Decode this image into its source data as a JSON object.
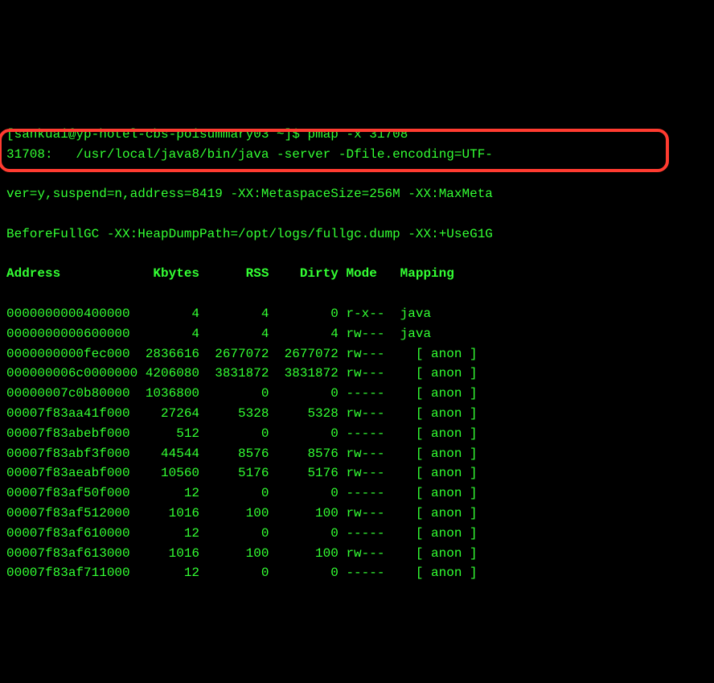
{
  "prompt": {
    "user_host": "[sankuai@yp-hotel-cbs-poisummary03 ~]$",
    "command": "pmap -x 31708"
  },
  "proc_header": {
    "line1": "31708:   /usr/local/java8/bin/java -server -Dfile.encoding=UTF-",
    "line2": "ver=y,suspend=n,address=8419 -XX:MetaspaceSize=256M -XX:MaxMeta",
    "line3": "BeforeFullGC -XX:HeapDumpPath=/opt/logs/fullgc.dump -XX:+UseG1G"
  },
  "columns": {
    "c0": "Address",
    "c1": "Kbytes",
    "c2": "RSS",
    "c3": "Dirty",
    "c4": "Mode",
    "c5": "Mapping"
  },
  "rows": [
    {
      "addr": "0000000000400000",
      "kb": "4",
      "rss": "4",
      "dirty": "0",
      "mode": "r-x--",
      "map": "java"
    },
    {
      "addr": "0000000000600000",
      "kb": "4",
      "rss": "4",
      "dirty": "4",
      "mode": "rw---",
      "map": "java"
    },
    {
      "addr": "0000000000fec000",
      "kb": "2836616",
      "rss": "2677072",
      "dirty": "2677072",
      "mode": "rw---",
      "map": "  [ anon ]"
    },
    {
      "addr": "000000006c0000000",
      "kb": "4206080",
      "rss": "3831872",
      "dirty": "3831872",
      "mode": "rw---",
      "map": "  [ anon ]"
    },
    {
      "addr": "00000007c0b80000",
      "kb": "1036800",
      "rss": "0",
      "dirty": "0",
      "mode": "-----",
      "map": "  [ anon ]"
    },
    {
      "addr": "00007f83aa41f000",
      "kb": "27264",
      "rss": "5328",
      "dirty": "5328",
      "mode": "rw---",
      "map": "  [ anon ]"
    },
    {
      "addr": "00007f83abebf000",
      "kb": "512",
      "rss": "0",
      "dirty": "0",
      "mode": "-----",
      "map": "  [ anon ]"
    },
    {
      "addr": "00007f83abf3f000",
      "kb": "44544",
      "rss": "8576",
      "dirty": "8576",
      "mode": "rw---",
      "map": "  [ anon ]"
    },
    {
      "addr": "00007f83aeabf000",
      "kb": "10560",
      "rss": "5176",
      "dirty": "5176",
      "mode": "rw---",
      "map": "  [ anon ]"
    },
    {
      "addr": "00007f83af50f000",
      "kb": "12",
      "rss": "0",
      "dirty": "0",
      "mode": "-----",
      "map": "  [ anon ]"
    },
    {
      "addr": "00007f83af512000",
      "kb": "1016",
      "rss": "100",
      "dirty": "100",
      "mode": "rw---",
      "map": "  [ anon ]"
    },
    {
      "addr": "00007f83af610000",
      "kb": "12",
      "rss": "0",
      "dirty": "0",
      "mode": "-----",
      "map": "  [ anon ]"
    },
    {
      "addr": "00007f83af613000",
      "kb": "1016",
      "rss": "100",
      "dirty": "100",
      "mode": "rw---",
      "map": "  [ anon ]"
    },
    {
      "addr": "00007f83af711000",
      "kb": "12",
      "rss": "0",
      "dirty": "0",
      "mode": "-----",
      "map": "  [ anon ]"
    }
  ]
}
